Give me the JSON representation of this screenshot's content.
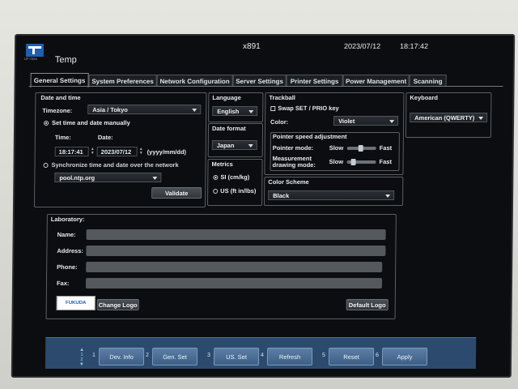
{
  "header": {
    "logo_sub": "UF-760A",
    "title": "Temp",
    "model": "x891",
    "date": "2023/07/12",
    "time": "18:17:42"
  },
  "tabs": [
    {
      "label": "General Settings"
    },
    {
      "label": "System Preferences"
    },
    {
      "label": "Network Configuration"
    },
    {
      "label": "Server Settings"
    },
    {
      "label": "Printer Settings"
    },
    {
      "label": "Power Management"
    },
    {
      "label": "Scanning"
    }
  ],
  "datetime": {
    "section": "Date and time",
    "timezone_label": "Timezone:",
    "timezone_value": "Asia / Tokyo",
    "manual_label": "Set time and date manually",
    "time_label": "Time:",
    "date_label": "Date:",
    "time_value": "18:17:41",
    "date_value": "2023/07/12",
    "date_format_hint": "(yyyy/mm/dd)",
    "sync_label": "Synchronize time and date over the network",
    "ntp_value": "pool.ntp.org",
    "validate_label": "Validate"
  },
  "language": {
    "section": "Language",
    "value": "English"
  },
  "date_format": {
    "section": "Date format",
    "value": "Japan"
  },
  "metrics": {
    "section": "Metrics",
    "option_si": "SI (cm/kg)",
    "option_us": "US (ft in/lbs)"
  },
  "trackball": {
    "section": "Trackball",
    "swap_label": "Swap SET / PRIO key",
    "color_label": "Color:",
    "color_value": "Violet",
    "pointer_speed_section": "Pointer speed adjustment",
    "pointer_mode_label": "Pointer mode:",
    "measurement_label_1": "Measurement",
    "measurement_label_2": "drawing mode:",
    "slow_label": "Slow",
    "fast_label": "Fast",
    "pointer_mode_level": 0.45,
    "measurement_mode_level": 0.15
  },
  "color_scheme": {
    "section": "Color Scheme",
    "value": "Black"
  },
  "keyboard": {
    "section": "Keyboard",
    "value": "American (QWERTY)"
  },
  "laboratory": {
    "section": "Laboratory:",
    "name_label": "Name:",
    "address_label": "Address:",
    "phone_label": "Phone:",
    "fax_label": "Fax:",
    "logo_text": "FUKUDA",
    "change_logo_label": "Change Logo",
    "default_logo_label": "Default Logo"
  },
  "footer": {
    "page_1": "1",
    "page_2": "2",
    "buttons": [
      {
        "num": "1",
        "label": "Dev. Info"
      },
      {
        "num": "2",
        "label": "Gen. Set"
      },
      {
        "num": "3",
        "label": "US. Set"
      },
      {
        "num": "4",
        "label": "Refresh"
      },
      {
        "num": "5",
        "label": "Reset"
      },
      {
        "num": "6",
        "label": "Apply"
      }
    ]
  },
  "colors": {
    "accent": "#2b4a6e",
    "screen_bg": "#0b0d10"
  }
}
